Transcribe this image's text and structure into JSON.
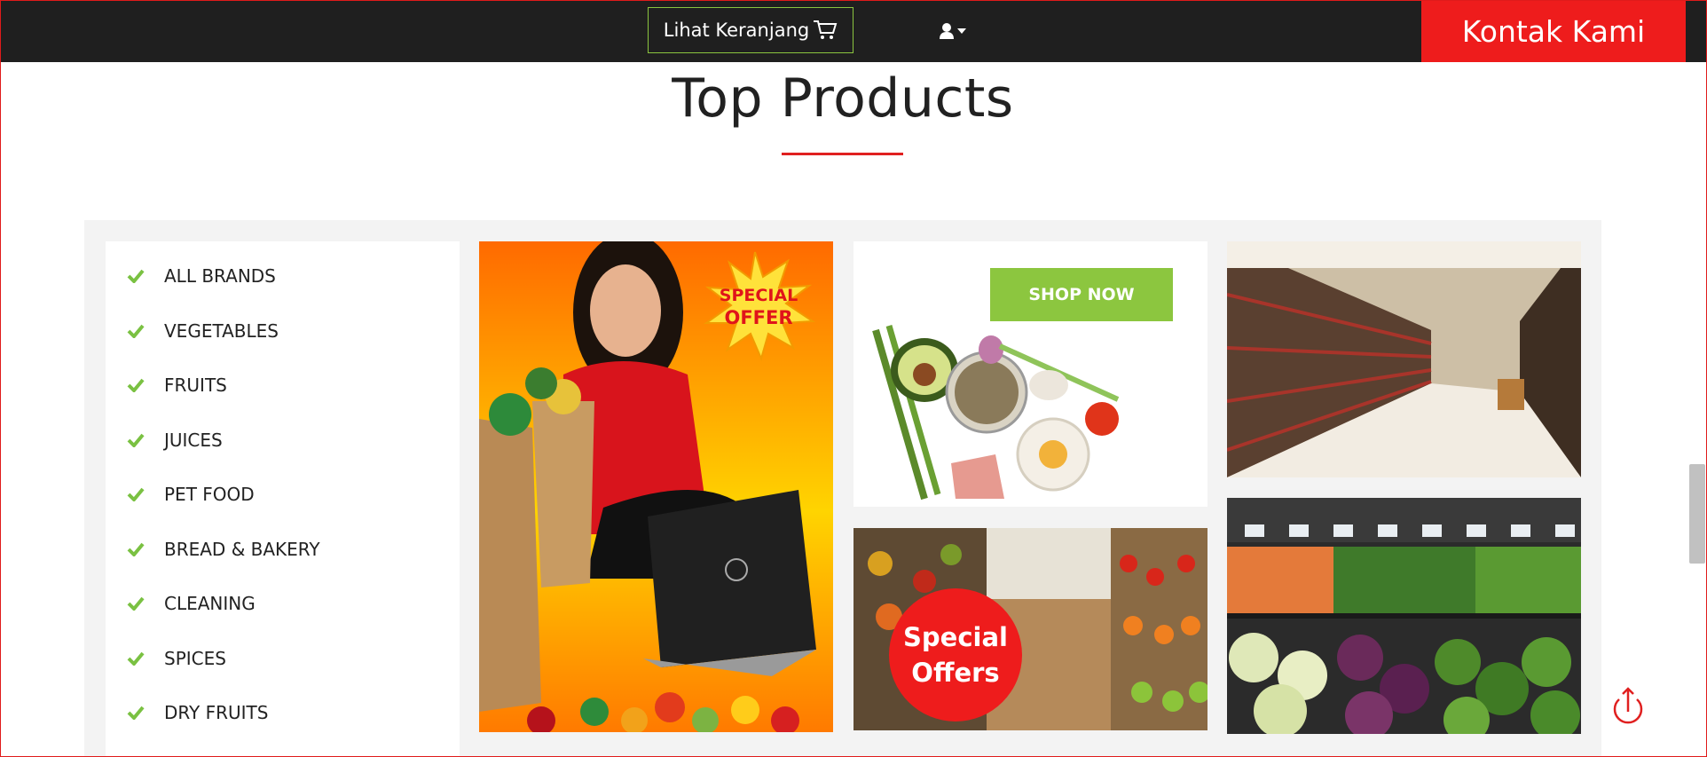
{
  "topbar": {
    "cart_label": "Lihat Keranjang",
    "contact_label": "Kontak Kami",
    "colors": {
      "bar": "#1f1f1f",
      "contact_bg": "#ee1c1c",
      "cart_border": "#8ac43f"
    },
    "icons": {
      "cart": "shopping-cart-icon",
      "user": "user-icon",
      "caret": "caret-down-icon"
    }
  },
  "section": {
    "title": "Top Products",
    "accent": "#e02020"
  },
  "categories": [
    {
      "label": "ALL BRANDS"
    },
    {
      "label": "VEGETABLES"
    },
    {
      "label": "FRUITS"
    },
    {
      "label": "JUICES"
    },
    {
      "label": "PET FOOD"
    },
    {
      "label": "BREAD & BAKERY"
    },
    {
      "label": "CLEANING"
    },
    {
      "label": "SPICES"
    },
    {
      "label": "DRY FRUITS"
    }
  ],
  "promos": {
    "offer_badge_line1": "SPECIAL",
    "offer_badge_line2": "OFFER",
    "shop_now": "SHOP NOW",
    "special_line1": "Special",
    "special_line2": "Offers"
  },
  "colors": {
    "check": "#7ac142",
    "shop_now_bg": "#8cc63f",
    "special_badge": "#ee1c1c"
  }
}
